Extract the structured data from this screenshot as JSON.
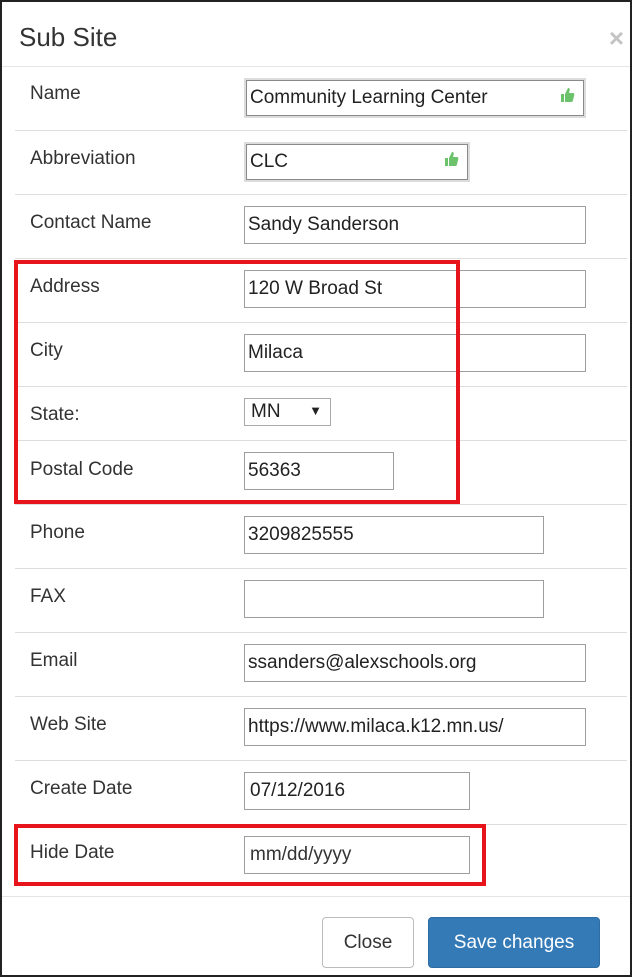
{
  "dialog": {
    "title": "Sub Site",
    "close_glyph": "×"
  },
  "fields": {
    "name": {
      "label": "Name",
      "value": "Community Learning Center"
    },
    "abbreviation": {
      "label": "Abbreviation",
      "value": "CLC"
    },
    "contact_name": {
      "label": "Contact Name",
      "value": "Sandy Sanderson"
    },
    "address": {
      "label": "Address",
      "value": "120 W Broad St"
    },
    "city": {
      "label": "City",
      "value": "Milaca"
    },
    "state": {
      "label": "State:",
      "value": "MN"
    },
    "postal_code": {
      "label": "Postal Code",
      "value": "56363"
    },
    "phone": {
      "label": "Phone",
      "value": "3209825555"
    },
    "fax": {
      "label": "FAX",
      "value": ""
    },
    "email": {
      "label": "Email",
      "value": "ssanders@alexschools.org"
    },
    "web_site": {
      "label": "Web Site",
      "value": "https://www.milaca.k12.mn.us/"
    },
    "create_date": {
      "label": "Create Date",
      "value": "07/12/2016"
    },
    "hide_date": {
      "label": "Hide Date",
      "placeholder": "mm/dd/yyyy"
    }
  },
  "footer": {
    "close_label": "Close",
    "save_label": "Save changes"
  },
  "icons": {
    "dropdown": "caret-down-icon",
    "field_helper": "thumbs-up-icon"
  },
  "colors": {
    "primary": "#337ab7",
    "highlight": "#e8141b"
  }
}
